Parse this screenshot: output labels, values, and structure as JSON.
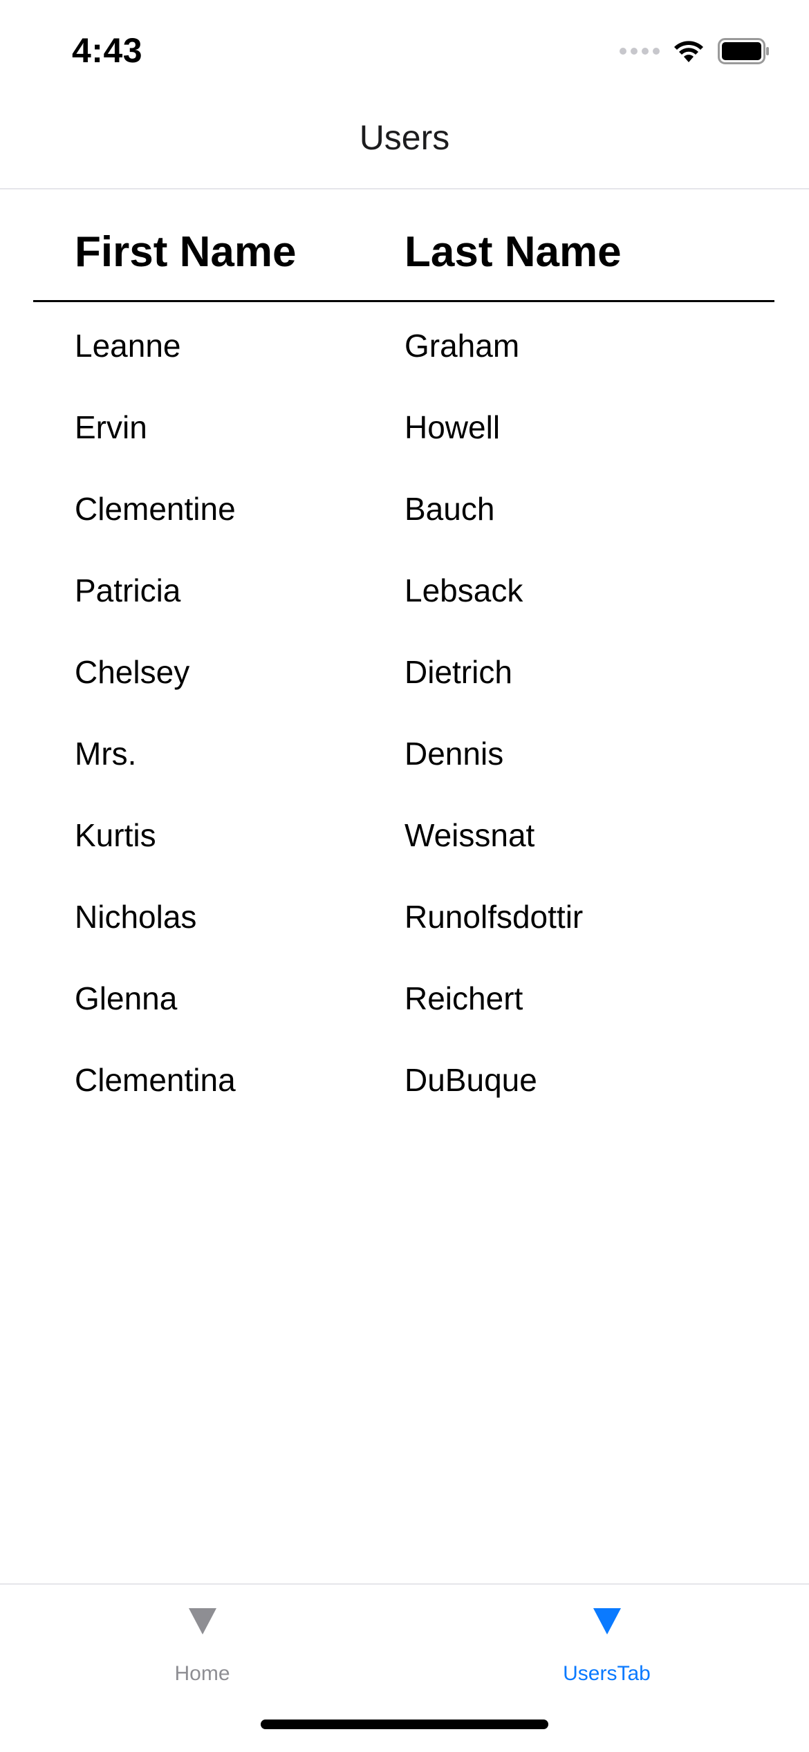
{
  "status_bar": {
    "time": "4:43",
    "icons": [
      "cellular-signal-icon",
      "wifi-icon",
      "battery-icon"
    ]
  },
  "nav": {
    "title": "Users"
  },
  "table": {
    "headers": {
      "first": "First Name",
      "last": "Last Name"
    },
    "rows": [
      {
        "first": "Leanne",
        "last": "Graham"
      },
      {
        "first": "Ervin",
        "last": "Howell"
      },
      {
        "first": "Clementine",
        "last": "Bauch"
      },
      {
        "first": "Patricia",
        "last": "Lebsack"
      },
      {
        "first": "Chelsey",
        "last": "Dietrich"
      },
      {
        "first": "Mrs.",
        "last": "Dennis"
      },
      {
        "first": "Kurtis",
        "last": "Weissnat"
      },
      {
        "first": "Nicholas",
        "last": "Runolfsdottir"
      },
      {
        "first": "Glenna",
        "last": "Reichert"
      },
      {
        "first": "Clementina",
        "last": "DuBuque"
      }
    ]
  },
  "tab_bar": {
    "tabs": [
      {
        "label": "Home",
        "icon": "triangle-down-icon",
        "selected": false
      },
      {
        "label": "UsersTab",
        "icon": "triangle-down-icon",
        "selected": true
      }
    ]
  },
  "colors": {
    "accent": "#0a7aff",
    "inactive": "#8e8e93",
    "separator": "#e5e5ea"
  }
}
